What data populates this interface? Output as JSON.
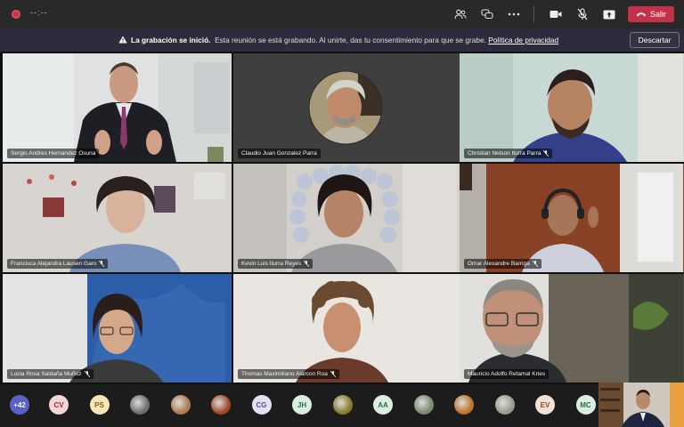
{
  "topbar": {
    "timer": "--:--",
    "leave_label": "Salir",
    "icons": [
      "participants-icon",
      "chat-icon",
      "more-icon",
      "camera-icon",
      "mic-off-icon",
      "share-icon"
    ]
  },
  "banner": {
    "bold": "La grabación se inició.",
    "text": "Esta reunión se está grabando. Al unirte, das tu consentimiento para que se grabe.",
    "link": "Política de privacidad",
    "dismiss_label": "Descartar"
  },
  "participants": [
    {
      "name": "Sergio Andres Hernandez Osuna",
      "mic": false
    },
    {
      "name": "Claudio Juan Gonzalez Parra",
      "mic": false
    },
    {
      "name": "Christian Nelson Iturra Parra",
      "mic": true
    },
    {
      "name": "Francisca Alejandra Lausen Garo",
      "mic": true
    },
    {
      "name": "Kevin Luis Iturra Reyes",
      "mic": true
    },
    {
      "name": "Omar Alexandre Barriga",
      "mic": true
    },
    {
      "name": "Lucia Rosa Saldaña Muñoz",
      "mic": true
    },
    {
      "name": "Thomas Maximiliano Alarcon Roa",
      "mic": true
    },
    {
      "name": "Mauricio Adolfo Retamal Kries",
      "mic": false
    }
  ],
  "roster": {
    "overflow": "+42",
    "avatars": [
      {
        "initials": "CV",
        "bg": "#f3d6d8",
        "fg": "#a4262c"
      },
      {
        "initials": "PS",
        "bg": "#f9e6b8",
        "fg": "#8a6100"
      },
      {
        "initials": "",
        "photo": "#6d6d6d"
      },
      {
        "initials": "",
        "photo": "#b07a4a"
      },
      {
        "initials": "",
        "photo": "#a14a2a"
      },
      {
        "initials": "CG",
        "bg": "#e6e0f5",
        "fg": "#5b4a9e"
      },
      {
        "initials": "JH",
        "bg": "#dbeee2",
        "fg": "#2c6e49"
      },
      {
        "initials": "",
        "photo": "#8a7a2a"
      },
      {
        "initials": "AA",
        "bg": "#dbeee2",
        "fg": "#2c6e49"
      },
      {
        "initials": "",
        "photo": "#7a8a6a"
      },
      {
        "initials": "",
        "photo": "#c0722a"
      },
      {
        "initials": "",
        "photo": "#9a9a8a"
      },
      {
        "initials": "EV",
        "bg": "#f3e1d6",
        "fg": "#8a4a1e"
      },
      {
        "initials": "MC",
        "bg": "#dbeee2",
        "fg": "#2c6e49"
      }
    ]
  }
}
